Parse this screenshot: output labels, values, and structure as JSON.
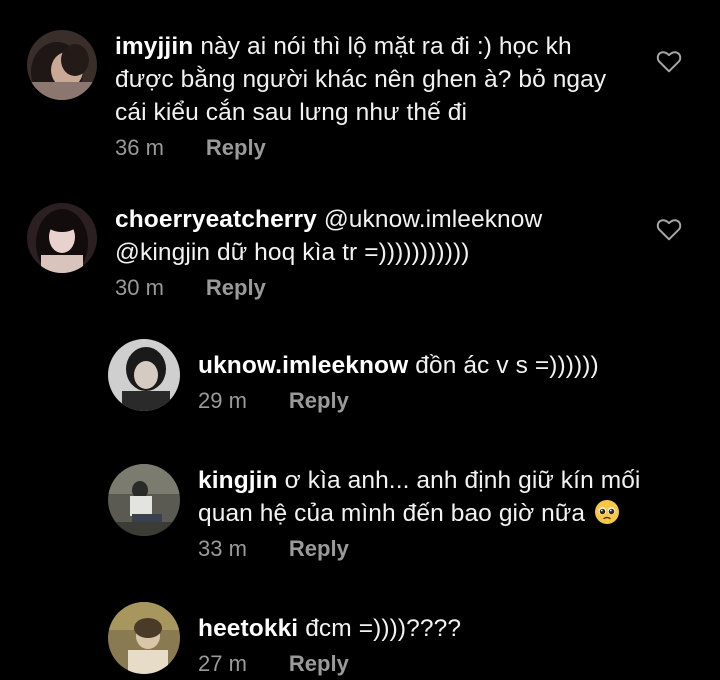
{
  "comments": [
    {
      "username": "imyjjin",
      "text": "này ai nói thì lộ mặt ra đi :) học kh được bằng người khác nên ghen à? bỏ ngay cái kiểu cắn sau lưng như thế đi",
      "time": "36 m",
      "reply": "Reply"
    },
    {
      "username": "choerryeatcherry",
      "text": "@uknow.imleeknow @kingjin dữ hoq kìa tr =)))))))))))",
      "time": "30 m",
      "reply": "Reply"
    }
  ],
  "replies": [
    {
      "username": "uknow.imleeknow",
      "text": "đồn ác v s =))))))",
      "time": "29 m",
      "reply": "Reply"
    },
    {
      "username": "kingjin",
      "text": "ơ kìa anh... anh định giữ kín mối quan hệ của mình đến bao giờ nữa",
      "emoji": "pleading-face-emoji",
      "time": "33 m",
      "reply": "Reply"
    },
    {
      "username": "heetokki",
      "text": "đcm =))))????",
      "time": "27 m",
      "reply": "Reply"
    }
  ],
  "icons": {
    "like": "heart-outline-icon"
  },
  "colors": {
    "background": "#000000",
    "text": "#f2f2f2",
    "meta": "#9a9a9a"
  }
}
